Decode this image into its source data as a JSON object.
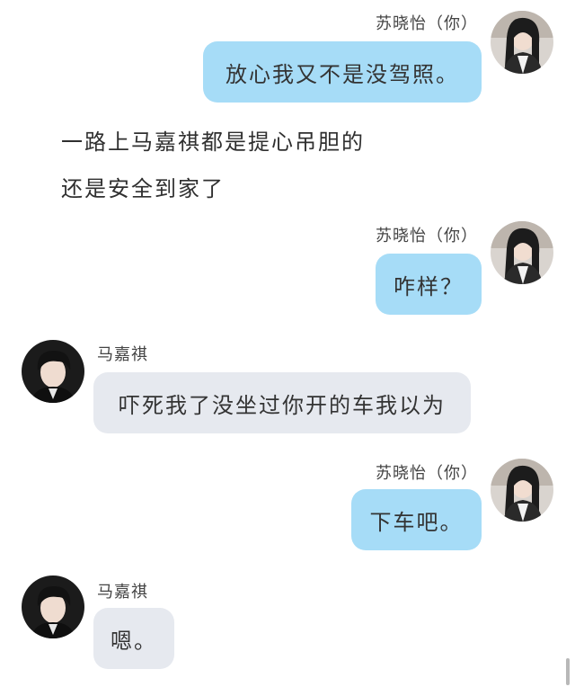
{
  "colors": {
    "me_bubble": "#a6dcf7",
    "other_bubble": "#e6e9ef",
    "background": "#ffffff"
  },
  "messages": [
    {
      "sender": "苏晓怡（你）",
      "text": "放心我又不是没驾照。",
      "side": "right",
      "avatar": "girl-avatar"
    },
    {
      "sender": "苏晓怡（你）",
      "text": "咋样？",
      "side": "right",
      "avatar": "girl-avatar"
    },
    {
      "sender": "马嘉祺",
      "text": "吓死我了没坐过你开的车我以为",
      "side": "left",
      "avatar": "boy-avatar"
    },
    {
      "sender": "苏晓怡（你）",
      "text": "下车吧。",
      "side": "right",
      "avatar": "girl-avatar"
    },
    {
      "sender": "马嘉祺",
      "text": "嗯。",
      "side": "left",
      "avatar": "boy-avatar"
    }
  ],
  "narration": [
    "一路上马嘉祺都是提心吊胆的",
    "还是安全到家了"
  ]
}
